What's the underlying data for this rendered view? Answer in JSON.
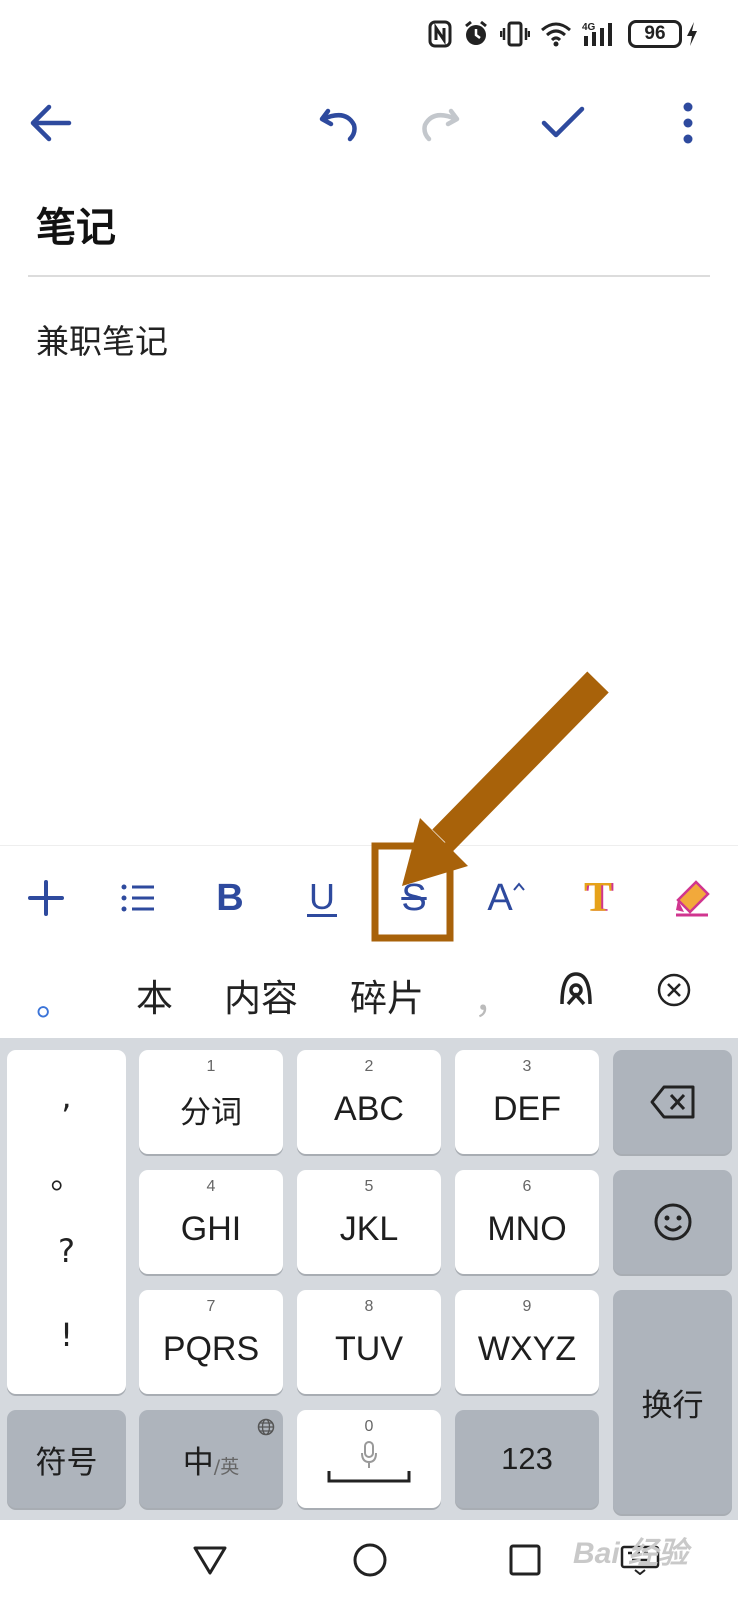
{
  "status": {
    "battery_level": "96"
  },
  "toolbar": {
    "icons": [
      "back-arrow-icon",
      "undo-icon",
      "redo-icon",
      "check-icon",
      "more-vertical-icon"
    ],
    "accent_color": "#2e4a9e",
    "disabled_color": "#c3c7cc"
  },
  "note": {
    "title": "笔记",
    "body": "兼职笔记"
  },
  "format_toolbar": {
    "bold_label": "B",
    "underline_label": "U",
    "strikethrough_label": "S",
    "font_size_label": "A",
    "text_color_label": "T"
  },
  "annotation": {
    "color": "#a8620a"
  },
  "candidates": {
    "dot": "。",
    "items": [
      "本",
      "内容",
      "碎片"
    ],
    "comma": "，"
  },
  "keyboard": {
    "punct": [
      ",",
      "。",
      "?",
      "!"
    ],
    "keys": [
      {
        "num": "1",
        "label": "分词"
      },
      {
        "num": "2",
        "label": "ABC"
      },
      {
        "num": "3",
        "label": "DEF"
      },
      {
        "num": "4",
        "label": "GHI"
      },
      {
        "num": "5",
        "label": "JKL"
      },
      {
        "num": "6",
        "label": "MNO"
      },
      {
        "num": "7",
        "label": "PQRS"
      },
      {
        "num": "8",
        "label": "TUV"
      },
      {
        "num": "9",
        "label": "WXYZ"
      }
    ],
    "symbols_label": "符号",
    "lang_main": "中",
    "lang_sub": "/英",
    "space_num": "0",
    "numbers_label": "123",
    "enter_label": "换行"
  },
  "watermark": "Bai 经验"
}
